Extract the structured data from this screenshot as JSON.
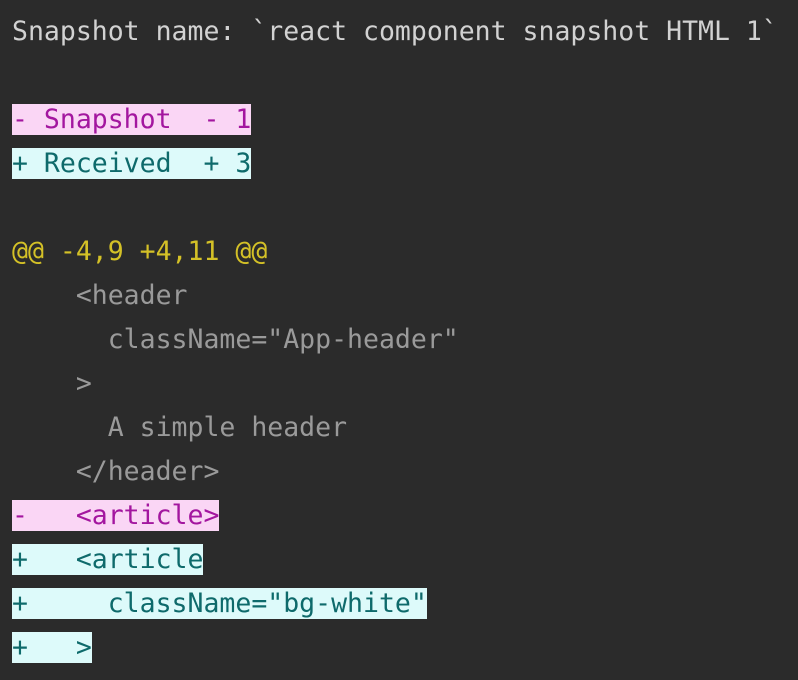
{
  "view": {
    "kind": "jest-snapshot-diff",
    "background_color": "#2b2b2b",
    "title_color": "#d2d2d2",
    "context_color": "#9a9a9a",
    "hunk_color": "#d4c127",
    "removed_text_color": "#a3169f",
    "removed_bg_color": "#fad6f5",
    "added_text_color": "#0e6a6b",
    "added_bg_color": "#ddfafa"
  },
  "snapshot": {
    "name_line": "Snapshot name: `react component snapshot HTML 1`",
    "snapshot_name": "react component snapshot HTML 1",
    "legend_removed": "- Snapshot  - 1",
    "legend_added": "+ Received  + 3",
    "removed_count": "1",
    "added_count": "3",
    "hunk_header": "@@ -4,9 +4,11 @@",
    "hunk_old_start": "4",
    "hunk_old_lines": "9",
    "hunk_new_start": "4",
    "hunk_new_lines": "11"
  },
  "lines": [
    {
      "kind": "title",
      "text": "Snapshot name: `react component snapshot HTML 1`"
    },
    {
      "kind": "blank",
      "text": " "
    },
    {
      "kind": "remove",
      "text": "- Snapshot  - 1"
    },
    {
      "kind": "add",
      "text": "+ Received  + 3"
    },
    {
      "kind": "blank",
      "text": " "
    },
    {
      "kind": "hunk",
      "text": "@@ -4,9 +4,11 @@"
    },
    {
      "kind": "context",
      "text": "    <header"
    },
    {
      "kind": "context",
      "text": "      className=\"App-header\""
    },
    {
      "kind": "context",
      "text": "    >"
    },
    {
      "kind": "context",
      "text": "      A simple header"
    },
    {
      "kind": "context",
      "text": "    </header>"
    },
    {
      "kind": "remove",
      "text": "-   <article>"
    },
    {
      "kind": "add",
      "text": "+   <article"
    },
    {
      "kind": "add",
      "text": "+     className=\"bg-white\""
    },
    {
      "kind": "add",
      "text": "+   >"
    }
  ]
}
